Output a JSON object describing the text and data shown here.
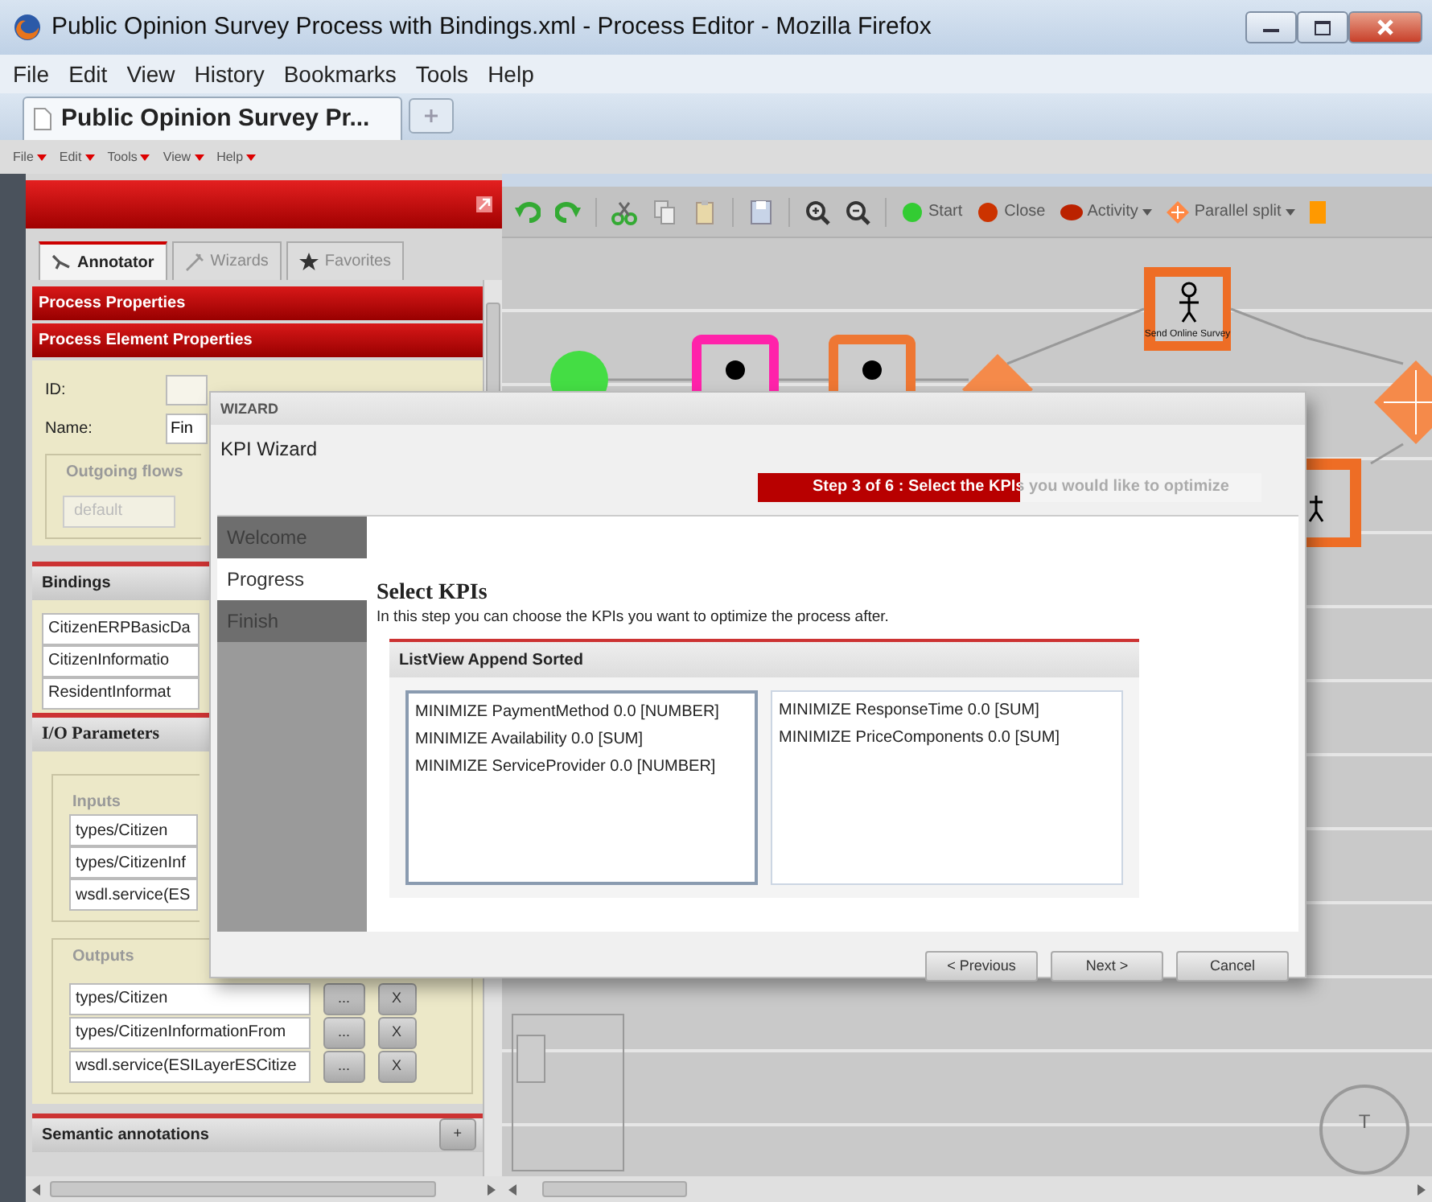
{
  "window": {
    "title": "Public Opinion Survey Process with Bindings.xml - Process Editor - Mozilla Firefox"
  },
  "menu_bar": [
    "File",
    "Edit",
    "View",
    "History",
    "Bookmarks",
    "Tools",
    "Help"
  ],
  "browser_tabs": [
    {
      "label": "Public Opinion Survey Pr...",
      "selected": true
    }
  ],
  "app_menu": [
    "File",
    "Edit",
    "Tools",
    "View",
    "Help"
  ],
  "left_panel": {
    "tabs": [
      {
        "label": "Annotator",
        "selected": true
      },
      {
        "label": "Wizards",
        "selected": false
      },
      {
        "label": "Favorites",
        "selected": false
      }
    ],
    "sections": [
      "Process Properties",
      "Process Element Properties"
    ],
    "id_label": "ID:",
    "name_label": "Name:",
    "name_value": "Fin",
    "outgoing_flows": {
      "legend": "Outgoing flows",
      "value": "default",
      "disabled": true
    },
    "bindings": {
      "title": "Bindings",
      "items": [
        "CitizenERPBasicDa",
        "CitizenInformatio",
        "ResidentInformat"
      ]
    },
    "io_title": "I/O Parameters",
    "inputs": {
      "legend": "Inputs",
      "items": [
        "types/Citizen",
        "types/CitizenInf",
        "wsdl.service(ES"
      ]
    },
    "outputs": {
      "legend": "Outputs",
      "items": [
        {
          "name": "types/Citizen",
          "edit": "...",
          "remove": "X"
        },
        {
          "name": "types/CitizenInformationFrom",
          "edit": "...",
          "remove": "X"
        },
        {
          "name": "wsdl.service(ESILayerESCitize",
          "edit": "...",
          "remove": "X"
        }
      ]
    },
    "semantic": {
      "title": "Semantic annotations",
      "add": "+"
    }
  },
  "toolbar": [
    {
      "label": "Start",
      "kind": "start",
      "dropdown": false
    },
    {
      "label": "Close",
      "kind": "end",
      "dropdown": false
    },
    {
      "label": "Activity",
      "kind": "activity",
      "dropdown": true
    },
    {
      "label": "Parallel split",
      "kind": "gateway",
      "dropdown": true
    }
  ],
  "diagram": {
    "task_label": "Send Online Survey"
  },
  "compass": {
    "label": "T"
  },
  "wizard": {
    "header": "WIZARD",
    "title": "KPI Wizard",
    "step": {
      "text": "Step 3 of 6 : Select the KPIs you would like to optimize",
      "level": 0.52
    },
    "steps": [
      {
        "label": "Welcome",
        "selected": false
      },
      {
        "label": "Progress",
        "selected": true
      },
      {
        "label": "Finish",
        "selected": false
      }
    ],
    "heading": "Select KPIs",
    "description": "In this step you can choose the KPIs you want to optimize the process after.",
    "panel_title": "ListView Append Sorted",
    "available": [
      "MINIMIZE PaymentMethod 0.0 [NUMBER]",
      "MINIMIZE Availability 0.0 [SUM]",
      "MINIMIZE ServiceProvider 0.0 [NUMBER]"
    ],
    "chosen": [
      "MINIMIZE ResponseTime 0.0 [SUM]",
      "MINIMIZE PriceComponents 0.0 [SUM]"
    ],
    "buttons": [
      "< Previous",
      "Next >",
      "Cancel"
    ]
  }
}
